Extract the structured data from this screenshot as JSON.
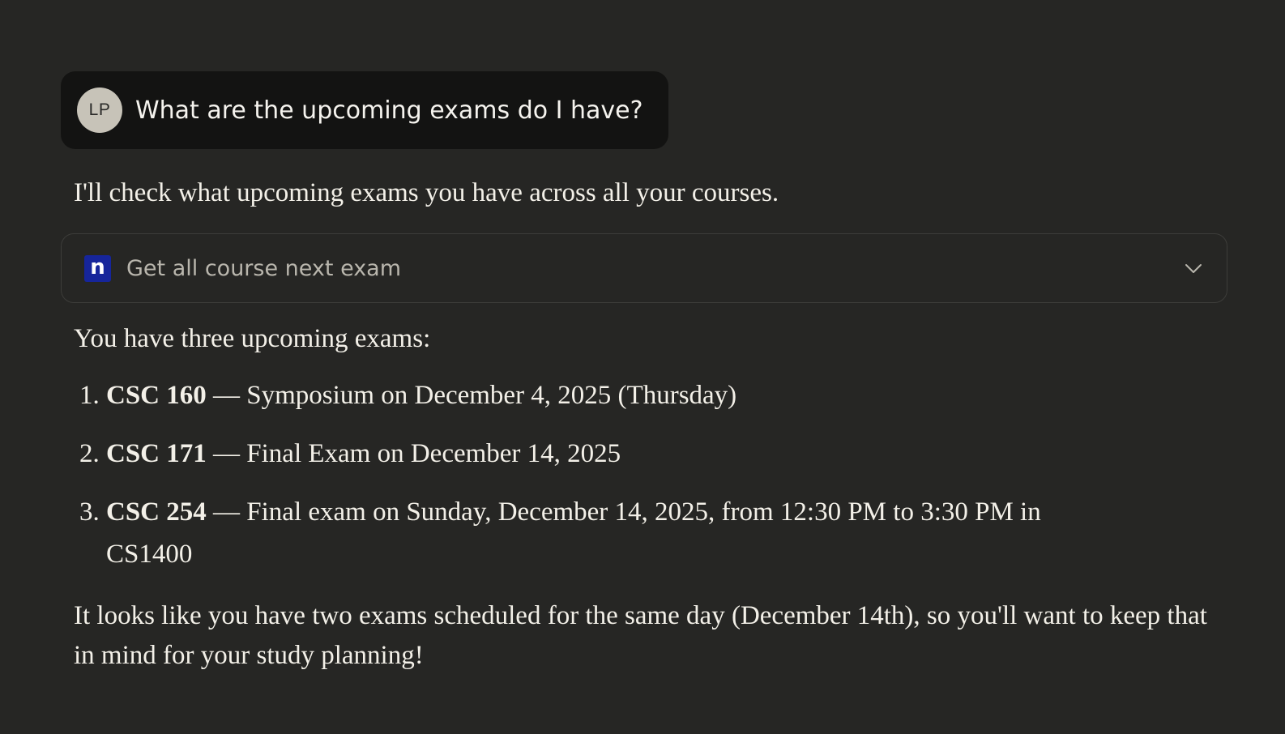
{
  "user_message": {
    "avatar_initials": "LP",
    "text": "What are the upcoming exams do I have?"
  },
  "assistant": {
    "intro": "I'll check what upcoming exams you have across all your courses.",
    "tool_call": {
      "icon": "n",
      "icon_color": "#16259b",
      "label": "Get all course next exam",
      "expanded": false
    },
    "lead": "You have three upcoming exams:",
    "exams": [
      {
        "number": "1.",
        "course": "CSC 160",
        "details": " — Symposium on December 4, 2025 (Thursday)"
      },
      {
        "number": "2.",
        "course": "CSC 171",
        "details": " — Final Exam on December 14, 2025"
      },
      {
        "number": "3.",
        "course": "CSC 254",
        "details": " — Final exam on Sunday, December 14, 2025, from 12:30 PM to 3:30 PM in CS1400"
      }
    ],
    "closing": "It looks like you have two exams scheduled for the same day (December 14th), so you'll want to keep that in mind for your study planning!"
  },
  "colors": {
    "background": "#262624",
    "user_bubble": "#131312",
    "avatar": "#c7c3b8",
    "text": "#f3f0e8",
    "muted_text": "#b9b6ad",
    "border": "#3d3d3a"
  }
}
